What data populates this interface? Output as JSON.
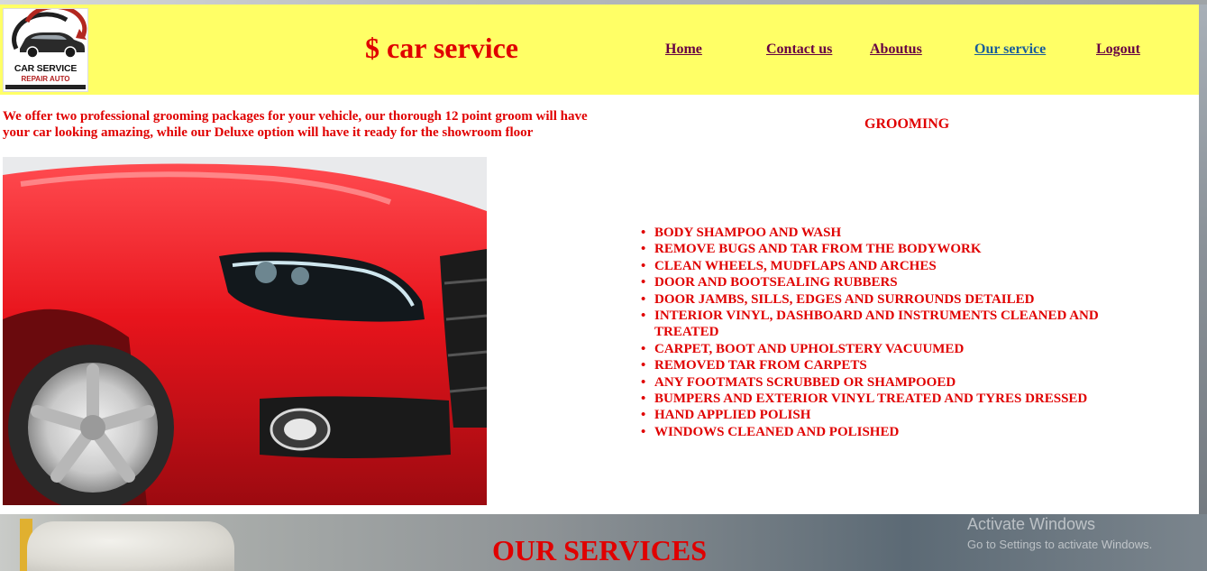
{
  "brand": {
    "logo_line1": "CAR SERVICE",
    "logo_line2": "REPAIR AUTO",
    "site_title": "$ car service"
  },
  "nav": {
    "items": [
      {
        "label": "Home"
      },
      {
        "label": "Contact us"
      },
      {
        "label": "Aboutus"
      },
      {
        "label": "Our service",
        "active": true
      },
      {
        "label": "Logout"
      }
    ]
  },
  "grooming": {
    "intro": "We offer two professional grooming packages for your vehicle, our thorough 12 point groom will have your car looking amazing, while our Deluxe option will have it ready for the showroom floor",
    "heading": "GROOMING",
    "items": [
      "BODY SHAMPOO AND WASH",
      "REMOVE BUGS AND TAR FROM THE BODYWORK",
      "CLEAN WHEELS, MUDFLAPS AND ARCHES",
      "DOOR AND BOOTSEALING RUBBERS",
      "DOOR JAMBS, SILLS, EDGES AND SURROUNDS DETAILED",
      "INTERIOR VINYL, DASHBOARD AND INSTRUMENTS CLEANED AND TREATED",
      "CARPET, BOOT AND UPHOLSTERY VACUUMED",
      "REMOVED TAR FROM CARPETS",
      "ANY FOOTMATS SCRUBBED OR SHAMPOOED",
      "BUMPERS AND EXTERIOR VINYL TREATED AND TYRES DRESSED",
      "HAND APPLIED POLISH",
      "WINDOWS CLEANED AND POLISHED"
    ]
  },
  "services_section": {
    "heading": "OUR SERVICES"
  },
  "os_watermark": {
    "title": "Activate Windows",
    "subtitle": "Go to Settings to activate Windows."
  },
  "colors": {
    "header_bg": "#ffff66",
    "accent_red": "#e00000",
    "nav_link": "#660044",
    "nav_link_active": "#1a5d9a",
    "car_red": "#e8141c"
  }
}
